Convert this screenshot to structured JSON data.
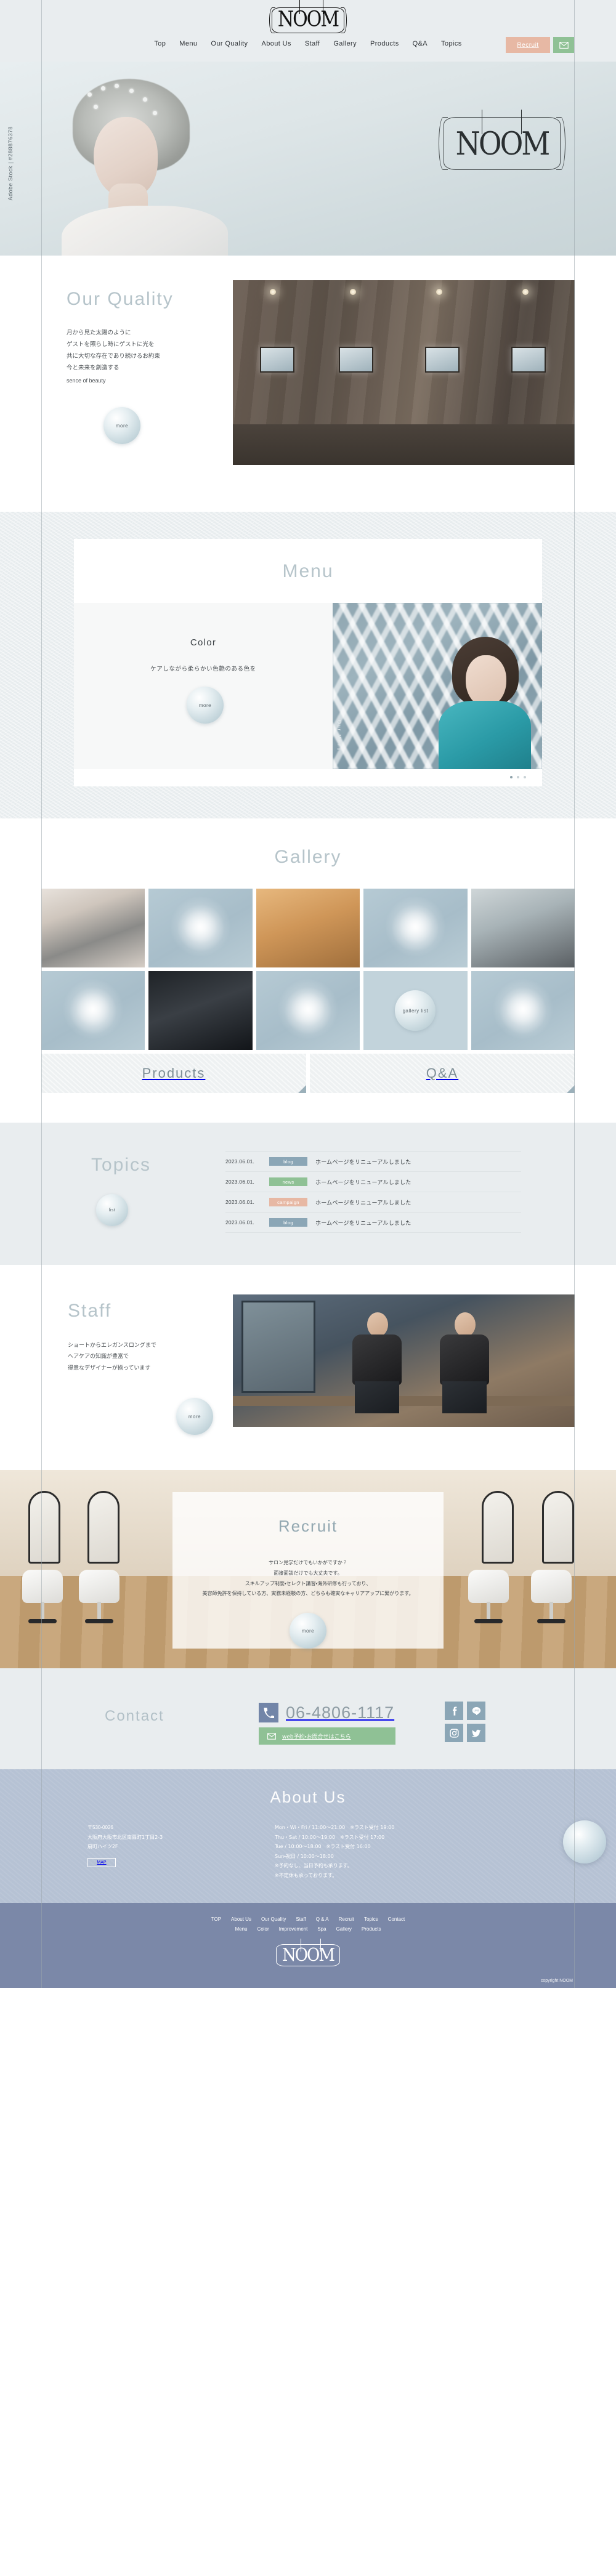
{
  "site": {
    "logo_text": "NOOM",
    "copyright": "copyright NOOM"
  },
  "header": {
    "nav": [
      {
        "label": "Top"
      },
      {
        "label": "Menu"
      },
      {
        "label": "Our Quality"
      },
      {
        "label": "About Us"
      },
      {
        "label": "Staff"
      },
      {
        "label": "Gallery"
      },
      {
        "label": "Products"
      },
      {
        "label": "Q&A"
      },
      {
        "label": "Topics"
      }
    ],
    "recruit_button": "Recruit",
    "mail_button_name": "mail-icon",
    "colors": {
      "recruit": "#e7b8a4",
      "mail": "#8fc195"
    }
  },
  "hero": {
    "logo_text": "NOOM",
    "watermark": "Adobe Stock | #288876378"
  },
  "quality": {
    "title": "Our Quality",
    "lines": [
      "月から見た太陽のように",
      "ゲストを照らし時にゲストに光を",
      "共に大切な存在であり続けるお約束",
      "今と未来を創造する"
    ],
    "sub": "sence of beauty",
    "more": "more"
  },
  "menu": {
    "title": "Menu",
    "item_title": "Color",
    "item_desc": "ケアしながら柔らかい色艶のある色を",
    "more": "more",
    "vertical_label": "Our Menu",
    "dots": 3,
    "active_dot": 1
  },
  "gallery": {
    "title": "Gallery",
    "more": "gallery list",
    "cells": [
      {
        "name": "gallery-photo-1",
        "style": "g-a"
      },
      {
        "name": "gallery-photo-2",
        "style": "g-blank"
      },
      {
        "name": "gallery-photo-3",
        "style": "g-c"
      },
      {
        "name": "gallery-photo-4",
        "style": "g-blank"
      },
      {
        "name": "gallery-photo-5",
        "style": "g-d"
      },
      {
        "name": "gallery-photo-6",
        "style": "g-blank"
      },
      {
        "name": "gallery-photo-7",
        "style": "g-e"
      },
      {
        "name": "gallery-photo-8",
        "style": "g-blank"
      },
      {
        "name": "gallery-more",
        "style": "g-more-cell"
      },
      {
        "name": "gallery-photo-9",
        "style": "g-blank"
      }
    ]
  },
  "banners": [
    {
      "label": "Products"
    },
    {
      "label": "Q&A"
    }
  ],
  "topics": {
    "title": "Topics",
    "more": "list",
    "rows": [
      {
        "date": "2023.06.01.",
        "tag": "blog",
        "tag_color": "#8ba6b6",
        "text": "ホームページをリニューアルしました"
      },
      {
        "date": "2023.06.01.",
        "tag": "news",
        "tag_color": "#8fc195",
        "text": "ホームページをリニューアルしました"
      },
      {
        "date": "2023.06.01.",
        "tag": "campaign",
        "tag_color": "#e7b8a4",
        "text": "ホームページをリニューアルしました"
      },
      {
        "date": "2023.06.01.",
        "tag": "blog",
        "tag_color": "#8ba6b6",
        "text": "ホームページをリニューアルしました"
      }
    ]
  },
  "staff": {
    "title": "Staff",
    "lines": [
      "ショートからエレガンスロングまで",
      "ヘアケアの知識が豊富で",
      "得意なデザイナーが揃っています"
    ],
    "more": "more"
  },
  "recruit": {
    "title": "Recruit",
    "lines": [
      "サロン見学だけでもいかがですか？",
      "面接面談だけでも大丈夫です。",
      "スキルアップ制度・セレクト講習・海外研修も行っており、",
      "美容師免許を保持している方、実務未経験の方、どちらも確実なキャリアアップに繋がります。"
    ],
    "more": "more"
  },
  "contact": {
    "title": "Contact",
    "tel": "06-4806-1117",
    "tel_icon": "phone-icon",
    "mail_label": "web予約・お問合せはこちら",
    "mail_icon": "envelope-icon",
    "socials": [
      {
        "name": "facebook-icon",
        "glyph": "f"
      },
      {
        "name": "line-icon",
        "glyph": "LINE"
      },
      {
        "name": "instagram-icon",
        "glyph": "◉"
      },
      {
        "name": "twitter-icon",
        "glyph": "🐦"
      }
    ]
  },
  "about": {
    "title": "About Us",
    "address_lines": [
      "〒530-0026",
      "大阪府大阪市北区南扇町1丁目2-3",
      "扇町ハイツ2F"
    ],
    "map_button": "MAP",
    "hours_lines": [
      "Mon・Wi・Fri / 11:00〜21:00　※ラスト受付 19:00",
      "Thu・Sat / 10:00〜19:00　※ラスト受付 17:00",
      "Tue / 10:00〜18:00　※ラスト受付 16:00",
      "Sun・祝日 / 10:00〜18:00",
      "※予約なし、当日予約も承ります。",
      "※不定休も承っております。"
    ]
  },
  "footer": {
    "row1": [
      {
        "label": "TOP"
      },
      {
        "label": "About Us"
      },
      {
        "label": "Our Quality"
      },
      {
        "label": "Staff"
      },
      {
        "label": "Q & A"
      },
      {
        "label": "Recruit"
      },
      {
        "label": "Topics"
      },
      {
        "label": "Contact"
      }
    ],
    "row2": [
      {
        "label": "Menu"
      },
      {
        "label": "Color"
      },
      {
        "label": "Improvement"
      },
      {
        "label": "Spa"
      },
      {
        "label": "Gallery"
      },
      {
        "label": "Products"
      }
    ],
    "logo_text": "NOOM",
    "copyright": "copyright NOOM"
  }
}
